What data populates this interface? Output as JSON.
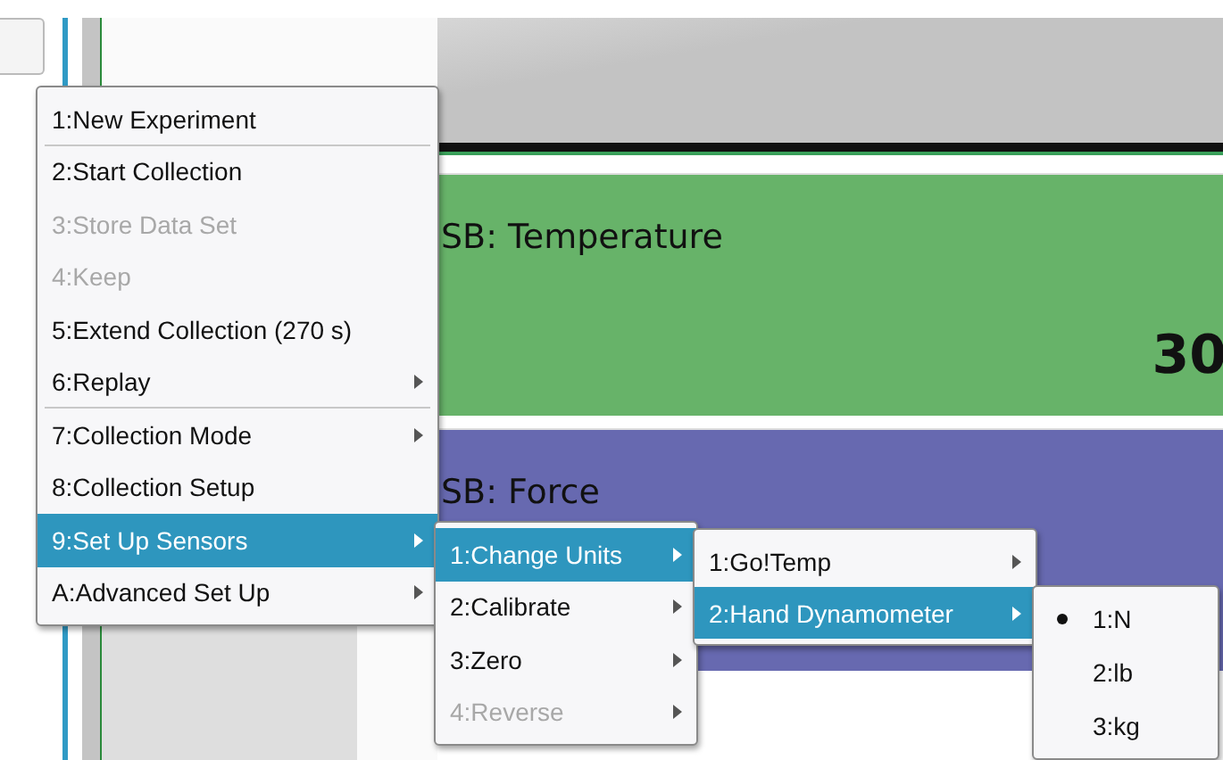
{
  "meters": [
    {
      "label": "SB: Temperature",
      "reading": "30",
      "color": "#67b369"
    },
    {
      "label": "SB: Force",
      "color": "#6769b0"
    }
  ],
  "menu": {
    "items": [
      {
        "label": "1:New Experiment",
        "selected": false,
        "disabled": false,
        "submenu_arrow": false,
        "separator_after": true
      },
      {
        "label": "2:Start Collection",
        "selected": false,
        "disabled": false,
        "submenu_arrow": false,
        "separator_after": false
      },
      {
        "label": "3:Store Data Set",
        "selected": false,
        "disabled": true,
        "submenu_arrow": false,
        "separator_after": false
      },
      {
        "label": "4:Keep",
        "selected": false,
        "disabled": true,
        "submenu_arrow": false,
        "separator_after": false
      },
      {
        "label": "5:Extend Collection (270 s)",
        "selected": false,
        "disabled": false,
        "submenu_arrow": false,
        "separator_after": false
      },
      {
        "label": "6:Replay",
        "selected": false,
        "disabled": false,
        "submenu_arrow": true,
        "separator_after": true
      },
      {
        "label": "7:Collection Mode",
        "selected": false,
        "disabled": false,
        "submenu_arrow": true,
        "separator_after": false
      },
      {
        "label": "8:Collection Setup",
        "selected": false,
        "disabled": false,
        "submenu_arrow": false,
        "separator_after": false
      },
      {
        "label": "9:Set Up Sensors",
        "selected": true,
        "disabled": false,
        "submenu_arrow": true,
        "separator_after": false,
        "submenu": {
          "items": [
            {
              "label": "1:Change Units",
              "selected": true,
              "disabled": false,
              "submenu_arrow": true,
              "separator_after": false,
              "submenu": {
                "items": [
                  {
                    "label": "1:Go!Temp",
                    "selected": false,
                    "disabled": false,
                    "submenu_arrow": true,
                    "separator_after": false
                  },
                  {
                    "label": "2:Hand Dynamometer",
                    "selected": true,
                    "disabled": false,
                    "submenu_arrow": true,
                    "separator_after": false,
                    "submenu": {
                      "items": [
                        {
                          "label": "1:N",
                          "selected": false,
                          "disabled": false,
                          "checked": true,
                          "submenu_arrow": false,
                          "separator_after": false
                        },
                        {
                          "label": "2:lb",
                          "selected": false,
                          "disabled": false,
                          "checked": false,
                          "submenu_arrow": false,
                          "separator_after": false
                        },
                        {
                          "label": "3:kg",
                          "selected": false,
                          "disabled": false,
                          "checked": false,
                          "submenu_arrow": false,
                          "separator_after": false
                        }
                      ]
                    }
                  }
                ]
              }
            },
            {
              "label": "2:Calibrate",
              "selected": false,
              "disabled": false,
              "submenu_arrow": true,
              "separator_after": false
            },
            {
              "label": "3:Zero",
              "selected": false,
              "disabled": false,
              "submenu_arrow": true,
              "separator_after": false
            },
            {
              "label": "4:Reverse",
              "selected": false,
              "disabled": true,
              "submenu_arrow": true,
              "separator_after": false
            }
          ]
        }
      },
      {
        "label": "A:Advanced Set Up",
        "selected": false,
        "disabled": false,
        "submenu_arrow": true,
        "separator_after": false
      }
    ]
  }
}
